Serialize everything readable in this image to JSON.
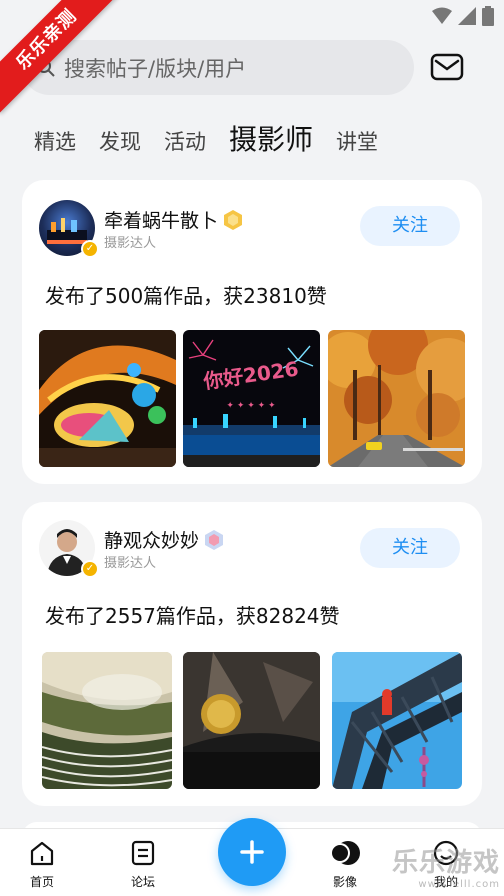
{
  "ribbon": "乐乐亲测",
  "search": {
    "placeholder": "搜索帖子/版块/用户"
  },
  "tabs": [
    "精选",
    "发现",
    "活动",
    "摄影师",
    "讲堂"
  ],
  "active_tab": "摄影师",
  "posts": [
    {
      "name": "牵着蜗牛散卜",
      "role": "摄影达人",
      "follow": "关注",
      "desc": "发布了500篇作品，获23810赞"
    },
    {
      "name": "静观众妙妙",
      "role": "摄影达人",
      "follow": "关注",
      "desc": "发布了2557篇作品，获82824赞"
    }
  ],
  "photo_text": {
    "fireworks": "你好2026"
  },
  "nav": {
    "home": "首页",
    "forum": "论坛",
    "image": "影像",
    "me": "我的"
  },
  "watermark": {
    "main": "乐乐游戏",
    "sub": "www.lelll.com"
  },
  "colors": {
    "accent": "#1e8ef2",
    "follow_bg": "#e9f3ff",
    "ribbon": "#e21c1c",
    "fab": "#1f9bf5"
  }
}
